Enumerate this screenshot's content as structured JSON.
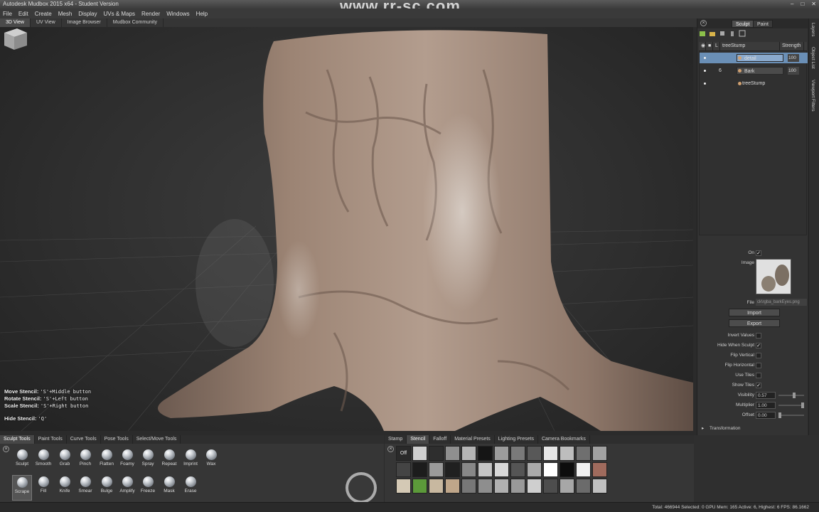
{
  "window": {
    "title": "Autodesk Mudbox 2015 x64 - Student Version",
    "watermark": "www.rr-sc.com",
    "controls": [
      "minimize-icon",
      "maximize-icon",
      "close-icon"
    ]
  },
  "menu": [
    "File",
    "Edit",
    "Create",
    "Mesh",
    "Display",
    "UVs & Maps",
    "Render",
    "Windows",
    "Help"
  ],
  "view_tabs": [
    "3D View",
    "UV View",
    "Image Browser",
    "Mudbox Community"
  ],
  "hints": [
    {
      "key": "Move Stencil:",
      "value": "'S'+Middle button"
    },
    {
      "key": "Rotate Stencil:",
      "value": "'S'+Left button"
    },
    {
      "key": "Scale Stencil:",
      "value": "'S'+Right button"
    },
    {
      "key": "Hide Stencil:",
      "value": "'Q'"
    }
  ],
  "right_panel": {
    "tabs": [
      "Sculpt",
      "Paint"
    ],
    "side_tabs": [
      "Layers",
      "Object List",
      "Viewport Filters"
    ],
    "layers_header": {
      "name": "treeStump",
      "strength": "Strength"
    },
    "layers": [
      {
        "name": "detail",
        "value": "100",
        "num": ""
      },
      {
        "name": "Bark",
        "value": "100",
        "num": "6"
      }
    ],
    "base_mesh": "treeStump",
    "stencil_props": {
      "on_label": "On",
      "image_label": "Image",
      "file_label": "File",
      "file_value": "ck\\rgba_barkEyes.png",
      "import_label": "Import",
      "export_label": "Export",
      "invert_values": "Invert Values",
      "hide_when_sculpt": "Hide When Sculpt",
      "flip_vertical": "Flip Vertical",
      "flip_horizontal": "Flip Horizontal",
      "use_tiles": "Use Tiles",
      "show_tiles": "Show Tiles",
      "visibility_label": "Visibility",
      "visibility_value": "0.57",
      "multiplier_label": "Multiplier",
      "multiplier_value": "1.00",
      "offset_label": "Offset",
      "offset_value": "0.00",
      "transformation": "Transformation"
    }
  },
  "tool_tabs": [
    "Sculpt Tools",
    "Paint Tools",
    "Curve Tools",
    "Pose Tools",
    "Select/Move Tools"
  ],
  "tools_row1": [
    "Sculpt",
    "Smooth",
    "Grab",
    "Pinch",
    "Flatten",
    "Foamy",
    "Spray",
    "Repeat",
    "Imprint",
    "Wax"
  ],
  "tools_row2": [
    "Scrape",
    "Fill",
    "Knife",
    "Smear",
    "Bulge",
    "Amplify",
    "Freeze",
    "Mask",
    "Erase"
  ],
  "stamp_tabs": [
    "Stamp",
    "Stencil",
    "Falloff",
    "Material Presets",
    "Lighting Presets",
    "Camera Bookmarks"
  ],
  "stamp_off_label": "Off",
  "status": "Total: 466944  Selected: 0 GPU Mem: 165  Active: 6, Highest: 6  FPS: 86.1662",
  "colors": {
    "selected_layer": "#6a8fb6",
    "stump": "#9c8373",
    "background": "#2b2b2b"
  }
}
